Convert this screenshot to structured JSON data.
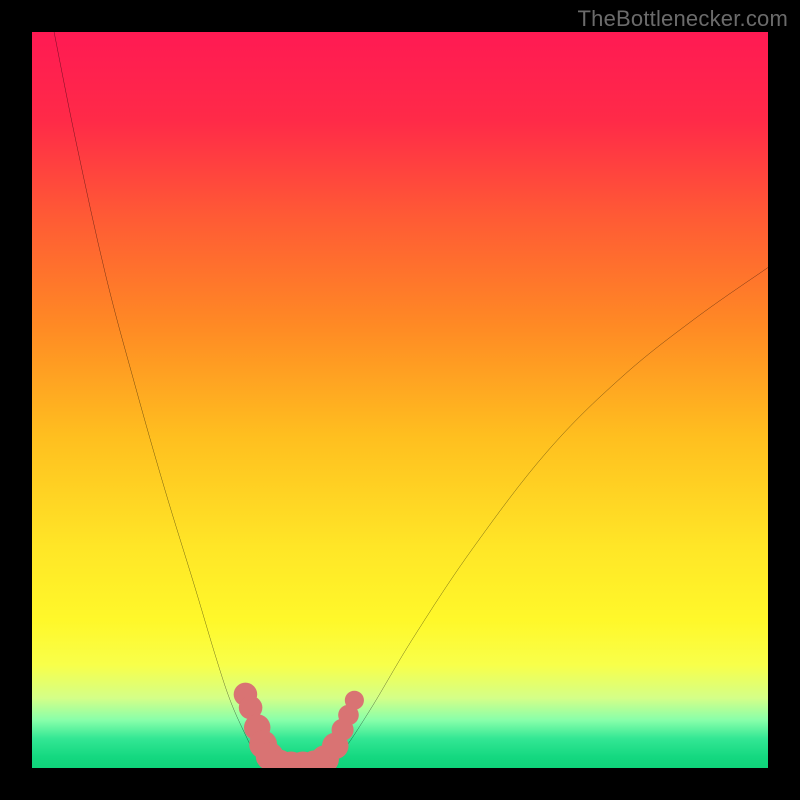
{
  "watermark": "TheBottlenecker.com",
  "gradient": {
    "stops": [
      {
        "offset": 0.0,
        "color": "#ff1a53"
      },
      {
        "offset": 0.12,
        "color": "#ff2a48"
      },
      {
        "offset": 0.25,
        "color": "#ff5a35"
      },
      {
        "offset": 0.4,
        "color": "#ff8a24"
      },
      {
        "offset": 0.55,
        "color": "#ffbf1f"
      },
      {
        "offset": 0.7,
        "color": "#ffe627"
      },
      {
        "offset": 0.8,
        "color": "#fff82a"
      },
      {
        "offset": 0.86,
        "color": "#f8ff4a"
      },
      {
        "offset": 0.905,
        "color": "#d4ff88"
      },
      {
        "offset": 0.935,
        "color": "#88ffaa"
      },
      {
        "offset": 0.96,
        "color": "#33e794"
      },
      {
        "offset": 0.985,
        "color": "#14d880"
      },
      {
        "offset": 1.0,
        "color": "#0fd37a"
      }
    ]
  },
  "chart_data": {
    "type": "line",
    "title": "",
    "xlabel": "",
    "ylabel": "",
    "xlim": [
      0,
      100
    ],
    "ylim": [
      0,
      100
    ],
    "series": [
      {
        "name": "left-branch",
        "x": [
          3,
          6,
          10,
          14,
          18,
          22,
          25,
          27,
          29,
          30,
          31,
          32
        ],
        "y": [
          100,
          85,
          67,
          52,
          38,
          25,
          15,
          9,
          4.5,
          2.5,
          1.0,
          0.4
        ]
      },
      {
        "name": "floor",
        "x": [
          32,
          33,
          34,
          36,
          38,
          40
        ],
        "y": [
          0.4,
          0.3,
          0.25,
          0.25,
          0.3,
          0.4
        ]
      },
      {
        "name": "right-branch",
        "x": [
          40,
          42,
          46,
          52,
          60,
          70,
          80,
          90,
          100
        ],
        "y": [
          0.4,
          2,
          8,
          18,
          30,
          43,
          53,
          61,
          68
        ]
      }
    ],
    "markers": {
      "name": "valley-dots",
      "color": "#d97373",
      "points": [
        {
          "x": 29.0,
          "y": 10.0,
          "r": 1.6
        },
        {
          "x": 29.7,
          "y": 8.2,
          "r": 1.6
        },
        {
          "x": 30.6,
          "y": 5.5,
          "r": 1.8
        },
        {
          "x": 31.4,
          "y": 3.2,
          "r": 1.9
        },
        {
          "x": 32.3,
          "y": 1.6,
          "r": 1.9
        },
        {
          "x": 33.6,
          "y": 0.6,
          "r": 1.9
        },
        {
          "x": 35.2,
          "y": 0.35,
          "r": 1.9
        },
        {
          "x": 36.8,
          "y": 0.35,
          "r": 1.9
        },
        {
          "x": 38.4,
          "y": 0.5,
          "r": 1.9
        },
        {
          "x": 39.8,
          "y": 1.2,
          "r": 1.9
        },
        {
          "x": 41.2,
          "y": 3.0,
          "r": 1.8
        },
        {
          "x": 42.2,
          "y": 5.2,
          "r": 1.5
        },
        {
          "x": 43.0,
          "y": 7.2,
          "r": 1.4
        },
        {
          "x": 43.8,
          "y": 9.2,
          "r": 1.3
        }
      ]
    }
  }
}
